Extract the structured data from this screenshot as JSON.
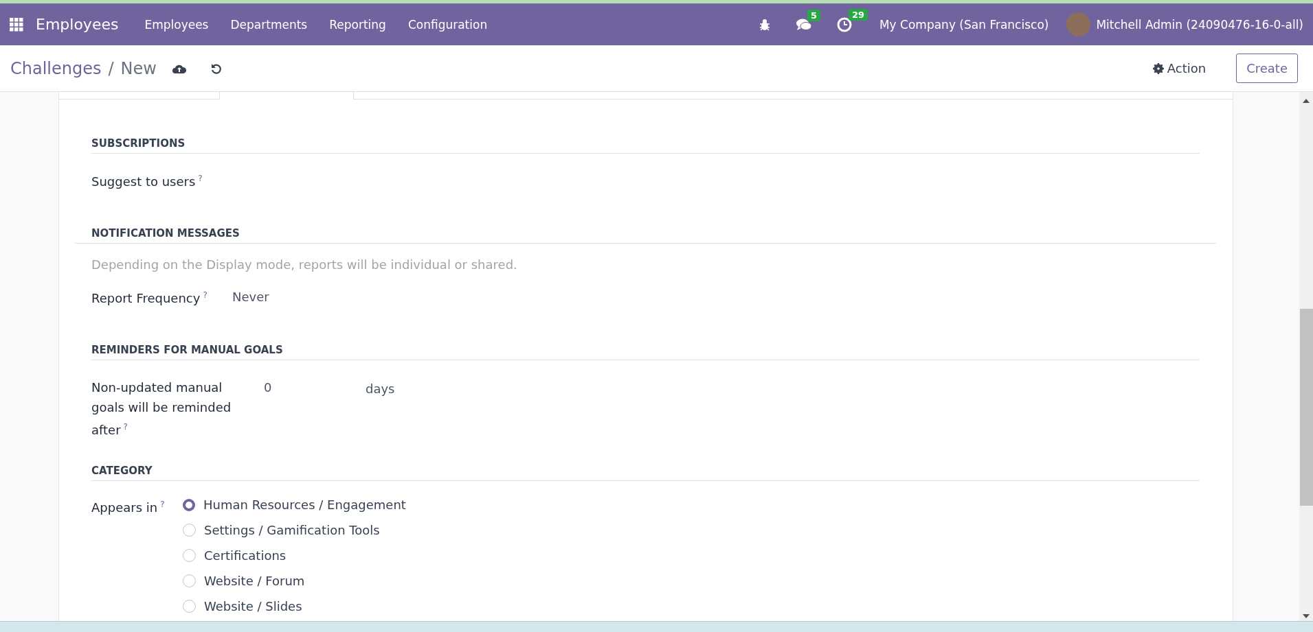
{
  "navbar": {
    "app_name": "Employees",
    "menu": [
      "Employees",
      "Departments",
      "Reporting",
      "Configuration"
    ],
    "messages_count": "5",
    "activities_count": "29",
    "company": "My Company (San Francisco)",
    "user": "Mitchell Admin (24090476-16-0-all)"
  },
  "control_panel": {
    "separator": "/",
    "breadcrumb": [
      {
        "label": "Challenges",
        "kind": "link"
      },
      {
        "label": "New",
        "kind": "current"
      }
    ],
    "action": "Action",
    "create": "Create"
  },
  "sections": [
    {
      "title": "SUBSCRIPTIONS",
      "kind": "fields",
      "fields": [
        {
          "label": "Suggest to users",
          "help": "?",
          "kind": "empty"
        }
      ]
    },
    {
      "title": "NOTIFICATION MESSAGES",
      "kind": "fields",
      "wide_rule": true,
      "note": "Depending on the Display mode, reports will be individual or shared.",
      "fields": [
        {
          "label": "Report Frequency",
          "help": "?",
          "kind": "select",
          "value": "Never"
        }
      ]
    },
    {
      "title": "REMINDERS FOR MANUAL GOALS",
      "kind": "fields",
      "fields": [
        {
          "label": "Non-updated manual goals will be reminded after",
          "help": "?",
          "kind": "number",
          "value": "0",
          "unit": "days"
        }
      ]
    },
    {
      "title": "CATEGORY",
      "kind": "radio",
      "label": "Appears in",
      "help": "?",
      "options": [
        {
          "label": "Human Resources / Engagement",
          "selected": true
        },
        {
          "label": "Settings / Gamification Tools",
          "selected": false
        },
        {
          "label": "Certifications",
          "selected": false
        },
        {
          "label": "Website / Forum",
          "selected": false
        },
        {
          "label": "Website / Slides",
          "selected": false
        }
      ]
    }
  ]
}
